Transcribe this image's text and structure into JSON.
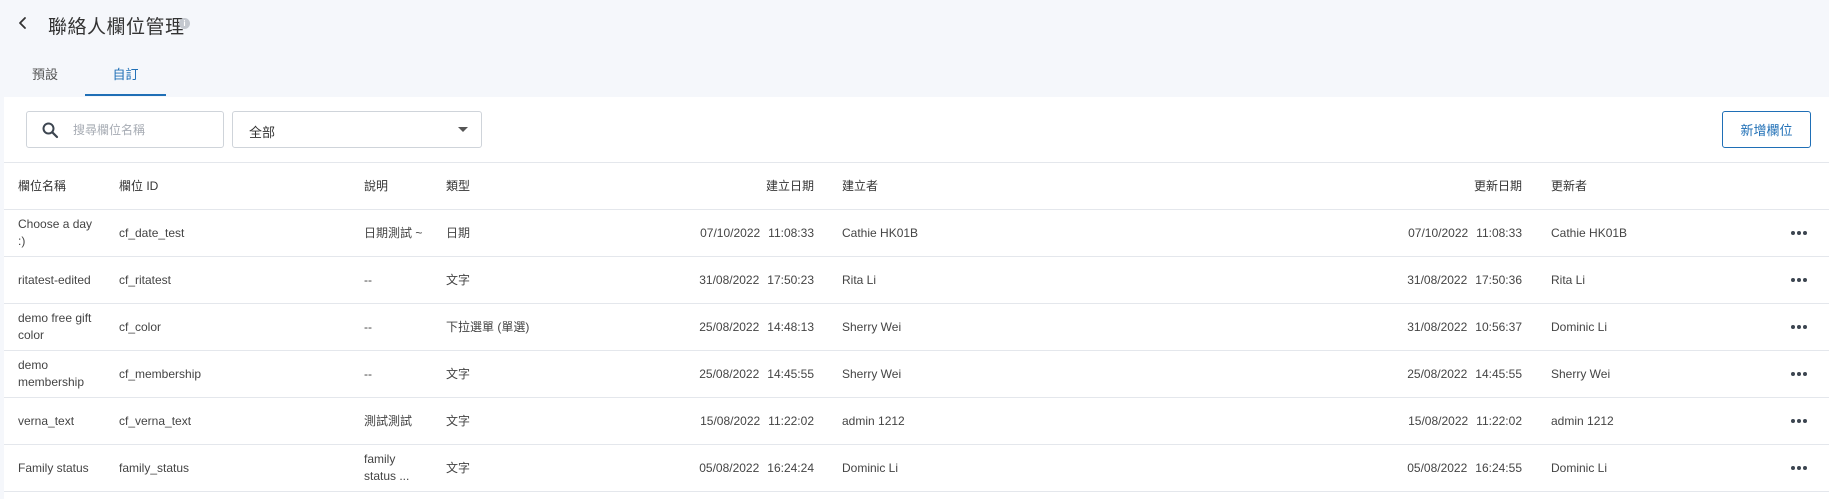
{
  "header": {
    "title": "聯絡人欄位管理",
    "info_glyph": "i"
  },
  "tabs": [
    {
      "label": "預設"
    },
    {
      "label": "自訂",
      "active": true
    }
  ],
  "toolbar": {
    "search_placeholder": "搜尋欄位名稱",
    "filter_value": "全部",
    "add_label": "新增欄位"
  },
  "table": {
    "headers": {
      "name": "欄位名稱",
      "id": "欄位 ID",
      "desc": "說明",
      "type": "類型",
      "created": "建立日期",
      "creator": "建立者",
      "updated": "更新日期",
      "updater": "更新者"
    },
    "rows": [
      {
        "name": "Choose a day :)",
        "id": "cf_date_test",
        "desc": "日期測試 ~",
        "type": "日期",
        "created_date": "07/10/2022",
        "created_time": "11:08:33",
        "creator": "Cathie HK01B",
        "updated_date": "07/10/2022",
        "updated_time": "11:08:33",
        "updater": "Cathie HK01B"
      },
      {
        "name": "ritatest-edited",
        "id": "cf_ritatest",
        "desc": "--",
        "type": "文字",
        "created_date": "31/08/2022",
        "created_time": "17:50:23",
        "creator": "Rita Li",
        "updated_date": "31/08/2022",
        "updated_time": "17:50:36",
        "updater": "Rita Li"
      },
      {
        "name": "demo free gift color",
        "id": "cf_color",
        "desc": "--",
        "type": "下拉選單 (單選)",
        "created_date": "25/08/2022",
        "created_time": "14:48:13",
        "creator": "Sherry Wei",
        "updated_date": "31/08/2022",
        "updated_time": "10:56:37",
        "updater": "Dominic Li"
      },
      {
        "name": "demo membership",
        "id": "cf_membership",
        "desc": "--",
        "type": "文字",
        "created_date": "25/08/2022",
        "created_time": "14:45:55",
        "creator": "Sherry Wei",
        "updated_date": "25/08/2022",
        "updated_time": "14:45:55",
        "updater": "Sherry Wei"
      },
      {
        "name": "verna_text",
        "id": "cf_verna_text",
        "desc": "測試測試",
        "type": "文字",
        "created_date": "15/08/2022",
        "created_time": "11:22:02",
        "creator": "admin 1212",
        "updated_date": "15/08/2022",
        "updated_time": "11:22:02",
        "updater": "admin 1212"
      },
      {
        "name": "Family status",
        "id": "family_status",
        "desc": "family status ...",
        "type": "文字",
        "created_date": "05/08/2022",
        "created_time": "16:24:24",
        "creator": "Dominic Li",
        "updated_date": "05/08/2022",
        "updated_time": "16:24:55",
        "updater": "Dominic Li"
      }
    ]
  }
}
